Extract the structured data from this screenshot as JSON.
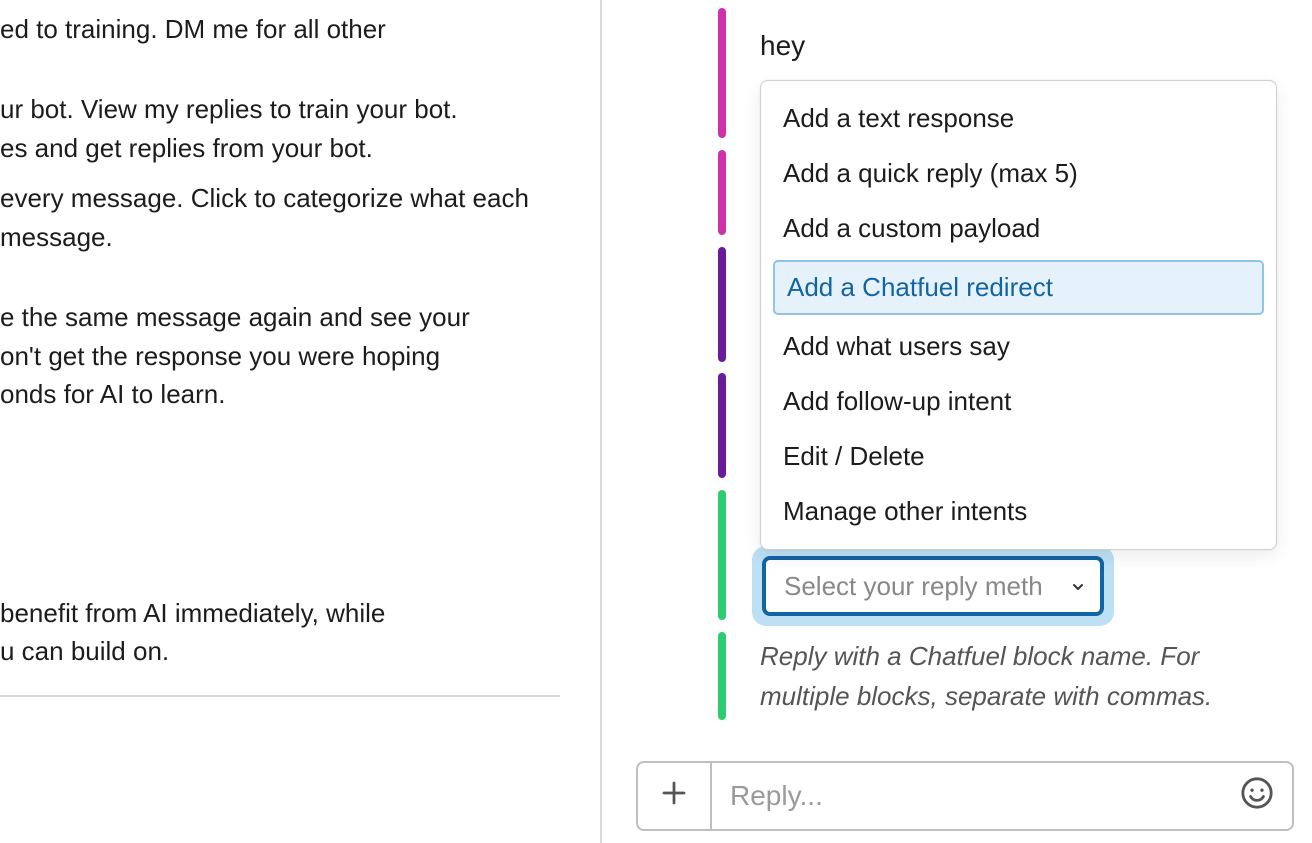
{
  "left": {
    "p1": "ed to training. DM me for all other",
    "p2a": "ur bot.   View my replies to train your bot.",
    "p2b": "es and get replies from your bot.",
    "p3a": " every message. Click to categorize what  each message.",
    "p4a": "e the same message again and see your",
    "p4b": "on't get the response you were hoping",
    "p4c": "onds for AI to learn.",
    "p5a": "benefit from AI immediately, while",
    "p5b": "u can build on."
  },
  "thread": {
    "user_text": "hey",
    "helper": "Reply with a Chatfuel block name. For multiple blocks, separate with commas."
  },
  "menu": {
    "items": [
      "Add a text response",
      "Add a quick reply (max 5)",
      "Add a custom payload",
      "Add a Chatfuel redirect",
      "Add what users say",
      "Add follow-up intent",
      "Edit / Delete",
      "Manage other intents"
    ],
    "selected_index": 3
  },
  "select": {
    "placeholder": "Select your reply meth"
  },
  "composer": {
    "placeholder": "Reply..."
  }
}
